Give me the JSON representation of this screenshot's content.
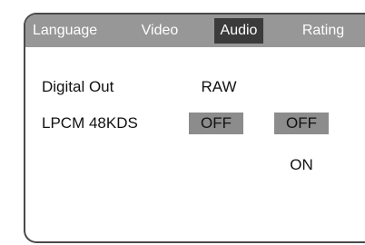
{
  "menu": {
    "tabs": [
      {
        "label": "Language",
        "active": false
      },
      {
        "label": "Video",
        "active": false
      },
      {
        "label": "Audio",
        "active": true
      },
      {
        "label": "Rating",
        "active": false
      }
    ]
  },
  "settings": [
    {
      "label": "Digital Out",
      "value": "RAW"
    },
    {
      "label": "LPCM 48KDS",
      "value": "OFF"
    }
  ],
  "options": [
    {
      "label": "OFF",
      "selected": true
    },
    {
      "label": "ON",
      "selected": false
    }
  ],
  "colors": {
    "tab_bar": "#979797",
    "active_tab": "#3b3b3b",
    "highlight": "#8c8c8c",
    "border": "#4a4a4a"
  }
}
